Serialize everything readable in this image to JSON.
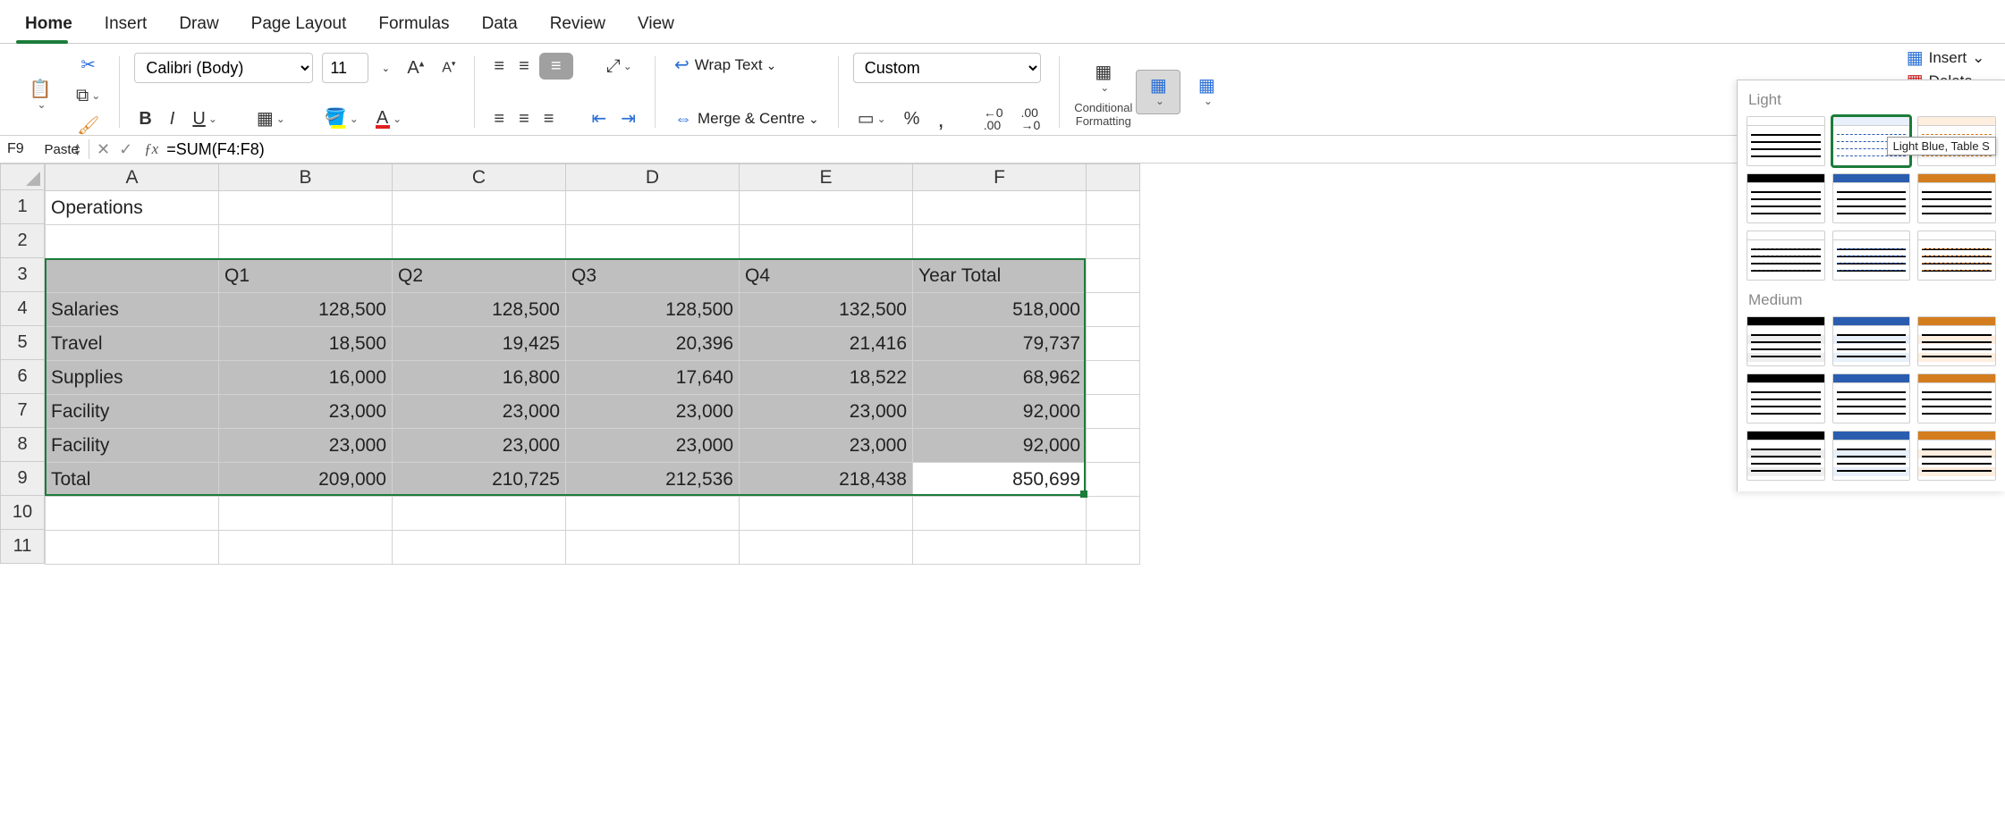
{
  "tabs": [
    "Home",
    "Insert",
    "Draw",
    "Page Layout",
    "Formulas",
    "Data",
    "Review",
    "View"
  ],
  "active_tab": 0,
  "ribbon": {
    "paste_label": "Paste",
    "font_name": "Calibri (Body)",
    "font_size": "11",
    "wrap_label": "Wrap Text",
    "merge_label": "Merge & Centre",
    "number_format": "Custom",
    "cond_fmt_label": "Conditional\nFormatting",
    "insert_label": "Insert",
    "delete_label": "Delete"
  },
  "name_box": "F9",
  "formula": "=SUM(F4:F8)",
  "columns": [
    "A",
    "B",
    "C",
    "D",
    "E",
    "F"
  ],
  "rows": [
    "1",
    "2",
    "3",
    "4",
    "5",
    "6",
    "7",
    "8",
    "9",
    "10",
    "11"
  ],
  "sheet": {
    "A1": "Operations",
    "header": [
      "",
      "Q1",
      "Q2",
      "Q3",
      "Q4",
      "Year Total"
    ],
    "data": [
      [
        "Salaries",
        "128,500",
        "128,500",
        "128,500",
        "132,500",
        "518,000"
      ],
      [
        "Travel",
        "18,500",
        "19,425",
        "20,396",
        "21,416",
        "79,737"
      ],
      [
        "Supplies",
        "16,000",
        "16,800",
        "17,640",
        "18,522",
        "68,962"
      ],
      [
        "Facility",
        "23,000",
        "23,000",
        "23,000",
        "23,000",
        "92,000"
      ],
      [
        "Facility",
        "23,000",
        "23,000",
        "23,000",
        "23,000",
        "92,000"
      ],
      [
        "Total",
        "209,000",
        "210,725",
        "212,536",
        "218,438",
        "850,699"
      ]
    ]
  },
  "gallery": {
    "light_label": "Light",
    "medium_label": "Medium",
    "tooltip": "Light Blue, Table S"
  }
}
